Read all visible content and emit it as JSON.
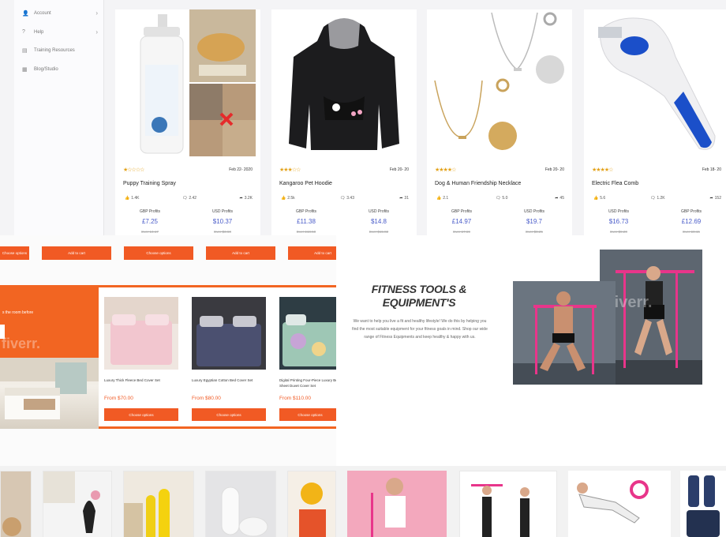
{
  "sidebar": {
    "items": [
      {
        "label": "Account",
        "icon": "user-icon",
        "has_chevron": true
      },
      {
        "label": "Help",
        "icon": "question-icon",
        "has_chevron": true
      },
      {
        "label": "Training Resources",
        "icon": "book-icon",
        "has_chevron": false
      },
      {
        "label": "Blog/Studio",
        "icon": "grid-icon",
        "has_chevron": false
      }
    ]
  },
  "products": [
    {
      "title": "Puppy Training Spray",
      "date": "Feb 22- 2020",
      "stats": [
        "1.4K",
        "2.42",
        "3.2K"
      ],
      "label_left": "GBP Profits",
      "value_left": "£7.25",
      "old_left": "Ever £4.17",
      "label_right": "USD Profits",
      "value_right": "$10.37",
      "old_right": "Ever $3.60",
      "rating": "★☆☆☆☆"
    },
    {
      "title": "Kangaroo Pet Hoodie",
      "date": "Feb 20- 20",
      "stats": [
        "2.5k",
        "3.43",
        "31"
      ],
      "label_left": "GBP Profits",
      "value_left": "£11.38",
      "old_left": "Ever £18.50",
      "label_right": "USD Profits",
      "value_right": "$14.8",
      "old_right": "Ever $15.82",
      "rating": "★★★☆☆"
    },
    {
      "title": "Dog & Human Friendship Necklace",
      "date": "Feb 20- 20",
      "stats": [
        "2.1",
        "5.0",
        "45"
      ],
      "label_left": "GBP Profits",
      "value_left": "£14.97",
      "old_left": "Ever £7.69",
      "label_right": "USD Profits",
      "value_right": "$19.7",
      "old_right": "Ever $8.25",
      "rating": "★★★★☆"
    },
    {
      "title": "Electric Flea Comb",
      "date": "Feb 18- 20",
      "stats": [
        "5.6",
        "1.2K",
        "152"
      ],
      "label_left": "USD Profits",
      "value_left": "$16.73",
      "old_left": "Ever $9.20",
      "label_right": "GBP Profits",
      "value_right": "£12.69",
      "old_right": "Ever £8.15",
      "rating": "★★★★☆"
    }
  ],
  "shop": {
    "top_buttons": [
      "Choose options",
      "Add to cart",
      "Choose options",
      "Add to cart",
      "Add to cart"
    ],
    "hero_text": "s the room before",
    "watermark": "fiverr.",
    "bed_products": [
      {
        "title": "Luxury Thick Fleece Bed Cover Set",
        "price": "From $70.00",
        "button": "Choose options"
      },
      {
        "title": "Luxury Egyptian Cotton Bed Cover Set",
        "price": "From $80.00",
        "button": "Choose options"
      },
      {
        "title": "Digital Printing Four-Piece Luxury Bed Sheet Duvet Cover Set",
        "price": "From $110.00",
        "button": "Choose options"
      }
    ]
  },
  "fitness": {
    "title_line1": "FITNESS TOOLS &",
    "title_line2": "EQUIPMENT'S",
    "description": "We want to help you live a fit and healthy lifestyle! We do this by helping you find the most suitable equipment for your fitness goals in mind. Shop our wide range of Fitness Equipments and keep healthy & happy with us.",
    "watermark": "fiverr."
  },
  "colors": {
    "accent_orange": "#f15a24",
    "price_blue": "#4a5cc9",
    "star_gold": "#e3a21a",
    "pink_bar": "#e8358a"
  }
}
